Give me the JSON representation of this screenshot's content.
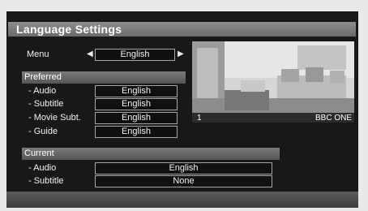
{
  "title": "Language Settings",
  "menu": {
    "label": "Menu",
    "value": "English"
  },
  "preferred": {
    "header": "Preferred",
    "rows": [
      {
        "label": "- Audio",
        "value": "English"
      },
      {
        "label": "- Subtitle",
        "value": "English"
      },
      {
        "label": "- Movie Subt.",
        "value": "English"
      },
      {
        "label": "- Guide",
        "value": "English"
      }
    ]
  },
  "current": {
    "header": "Current",
    "rows": [
      {
        "label": "- Audio",
        "value": "English"
      },
      {
        "label": "- Subtitle",
        "value": "None"
      }
    ]
  },
  "preview": {
    "channel_number": "1",
    "channel_name": "BBC ONE"
  }
}
